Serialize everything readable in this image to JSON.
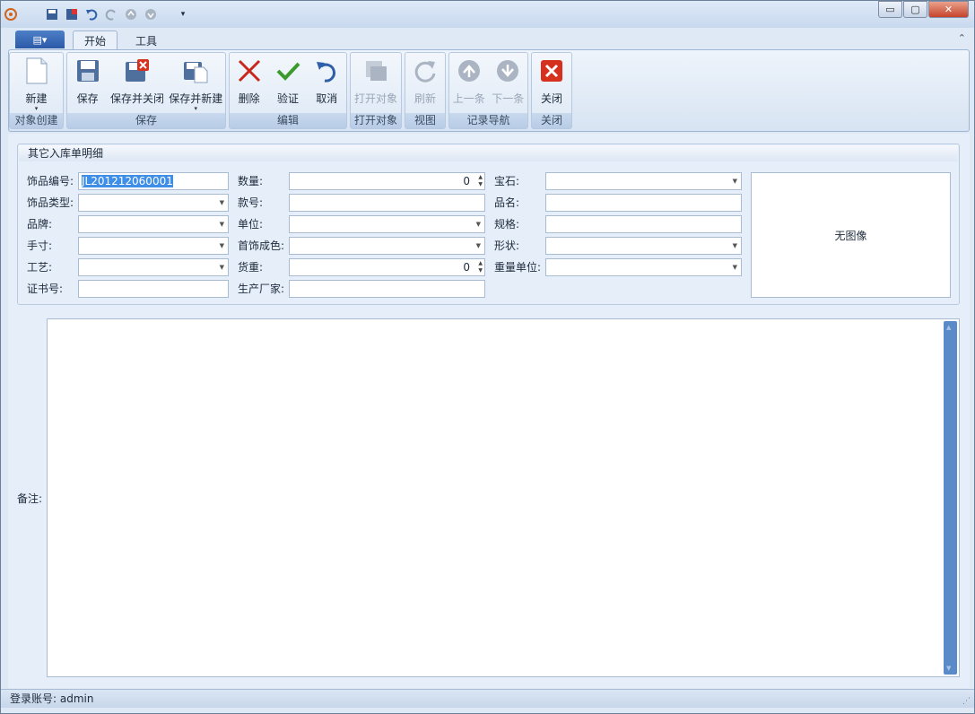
{
  "qat": {
    "icons": [
      "app-logo-icon",
      "save-icon",
      "save-close-icon",
      "undo-icon",
      "redo-icon",
      "up-icon",
      "down-icon",
      "customize-icon"
    ]
  },
  "window": {
    "minimize": "▭",
    "maximize": "▢",
    "close": "✕"
  },
  "tabs": {
    "app_menu": "▤▾",
    "start": "开始",
    "tools": "工具",
    "collapse": "⌃"
  },
  "ribbon": {
    "create": {
      "title": "对象创建",
      "new": "新建"
    },
    "save": {
      "title": "保存",
      "save": "保存",
      "save_close": "保存并关闭",
      "save_new": "保存并新建"
    },
    "edit": {
      "title": "编辑",
      "delete": "删除",
      "validate": "验证",
      "cancel": "取消"
    },
    "open": {
      "title": "打开对象",
      "open": "打开对象"
    },
    "view": {
      "title": "视图",
      "refresh": "刷新"
    },
    "nav": {
      "title": "记录导航",
      "prev": "上一条",
      "next": "下一条"
    },
    "close": {
      "title": "关闭",
      "close": "关闭"
    }
  },
  "form": {
    "title": "其它入库单明细",
    "fields": {
      "item_code": {
        "label": "饰品编号:",
        "value": "JL201212060001"
      },
      "item_type": {
        "label": "饰品类型:",
        "value": ""
      },
      "brand": {
        "label": "品牌:",
        "value": ""
      },
      "hand_size": {
        "label": "手寸:",
        "value": ""
      },
      "craft": {
        "label": "工艺:",
        "value": ""
      },
      "cert_no": {
        "label": "证书号:",
        "value": ""
      },
      "quantity": {
        "label": "数量:",
        "value": "0"
      },
      "style_no": {
        "label": "款号:",
        "value": ""
      },
      "unit": {
        "label": "单位:",
        "value": ""
      },
      "purity": {
        "label": "首饰成色:",
        "value": ""
      },
      "goods_weight": {
        "label": "货重:",
        "value": "0"
      },
      "manufacturer": {
        "label": "生产厂家:",
        "value": ""
      },
      "gem": {
        "label": "宝石:",
        "value": ""
      },
      "product_name": {
        "label": "品名:",
        "value": ""
      },
      "spec": {
        "label": "规格:",
        "value": ""
      },
      "shape": {
        "label": "形状:",
        "value": ""
      },
      "weight_unit": {
        "label": "重量单位:",
        "value": ""
      }
    },
    "image_placeholder": "无图像",
    "remark_label": "备注:"
  },
  "status": {
    "login": "登录账号: admin"
  }
}
